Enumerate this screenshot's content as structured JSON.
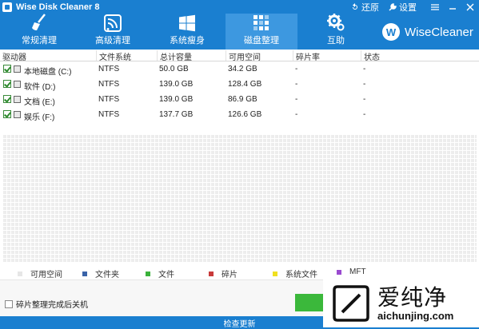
{
  "titlebar": {
    "title": "Wise Disk Cleaner 8",
    "restore_label": "还原",
    "settings_label": "设置"
  },
  "nav": {
    "items": [
      {
        "label": "常规清理",
        "icon": "broom-icon"
      },
      {
        "label": "高级清理",
        "icon": "radar-icon"
      },
      {
        "label": "系统瘦身",
        "icon": "windows-icon"
      },
      {
        "label": "磁盘整理",
        "icon": "defrag-blocks-icon",
        "active": true
      },
      {
        "label": "互助",
        "icon": "gear-icon"
      }
    ],
    "brand_logo": "W",
    "brand_name": "WiseCleaner"
  },
  "table": {
    "headers": [
      "驱动器",
      "文件系统",
      "总计容量",
      "可用空间",
      "碎片率",
      "状态"
    ],
    "rows": [
      {
        "checked": true,
        "drive": "本地磁盘 (C:)",
        "fs": "NTFS",
        "total": "50.0 GB",
        "free": "34.2 GB",
        "frag": "-",
        "status": "-"
      },
      {
        "checked": true,
        "drive": "软件 (D:)",
        "fs": "NTFS",
        "total": "139.0 GB",
        "free": "128.4 GB",
        "frag": "-",
        "status": "-"
      },
      {
        "checked": true,
        "drive": "文档 (E:)",
        "fs": "NTFS",
        "total": "139.0 GB",
        "free": "86.9 GB",
        "frag": "-",
        "status": "-"
      },
      {
        "checked": true,
        "drive": "娱乐 (F:)",
        "fs": "NTFS",
        "total": "137.7 GB",
        "free": "126.6 GB",
        "frag": "-",
        "status": "-"
      }
    ]
  },
  "legend": [
    {
      "label": "可用空间",
      "color": "#e6e6e6"
    },
    {
      "label": "文件夹",
      "color": "#3a63a8"
    },
    {
      "label": "文件",
      "color": "#3bb23b"
    },
    {
      "label": "碎片",
      "color": "#c83a3a"
    },
    {
      "label": "系统文件",
      "color": "#f0e020"
    },
    {
      "label": "MFT",
      "color": "#9a4ad0"
    }
  ],
  "bottom": {
    "shutdown_label": "碎片整理完成后关机",
    "status_text": "检查更新"
  },
  "watermark": {
    "cn": "爱纯净",
    "url": "aichunjing.com"
  },
  "colors": {
    "brand_blue": "#1a7fd0",
    "active_tab": "#3d98e0",
    "action_green": "#3bb83b"
  }
}
